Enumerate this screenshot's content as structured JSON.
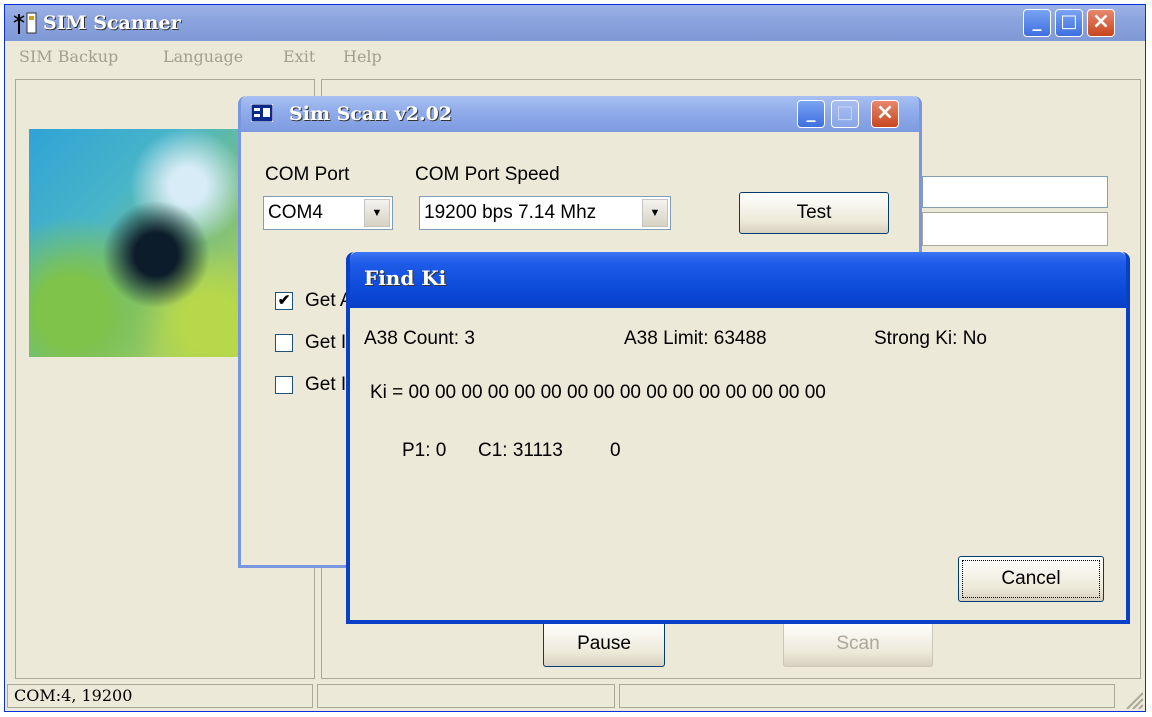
{
  "main_window": {
    "title": "SIM Scanner",
    "menu": [
      "SIM Backup",
      "Language",
      "Exit",
      "Help"
    ],
    "buttons": {
      "pause": "Pause",
      "scan": "Scan"
    },
    "status": {
      "port": "COM:4, 19200",
      "cell2": "",
      "cell3": ""
    }
  },
  "simscan": {
    "title": "Sim Scan v2.02",
    "com_port_label": "COM Port",
    "com_port_value": "COM4",
    "com_speed_label": "COM Port Speed",
    "com_speed_value": "19200 bps  7.14 Mhz",
    "test_label": "Test",
    "checks": [
      {
        "label": "Get A",
        "checked": true
      },
      {
        "label": "Get I",
        "checked": false
      },
      {
        "label": "Get I",
        "checked": false
      }
    ]
  },
  "findki": {
    "title": "Find Ki",
    "a38_count": "A38 Count:  3",
    "a38_limit": "A38 Limit:  63488",
    "strong_ki": "Strong Ki:  No",
    "ki_line": "Ki =   00 00 00 00 00 00 00 00 00 00 00 00 00 00 00 00",
    "p1": "P1: 0",
    "c1": "C1: 31113",
    "extra": "0",
    "cancel_label": "Cancel"
  },
  "icons": {
    "app": "antenna-card-icon",
    "dialog": "dialog-app-icon"
  },
  "colors": {
    "xp_blue": "#0a3fc8",
    "face": "#ece9d8",
    "close_red": "#c8461e"
  }
}
